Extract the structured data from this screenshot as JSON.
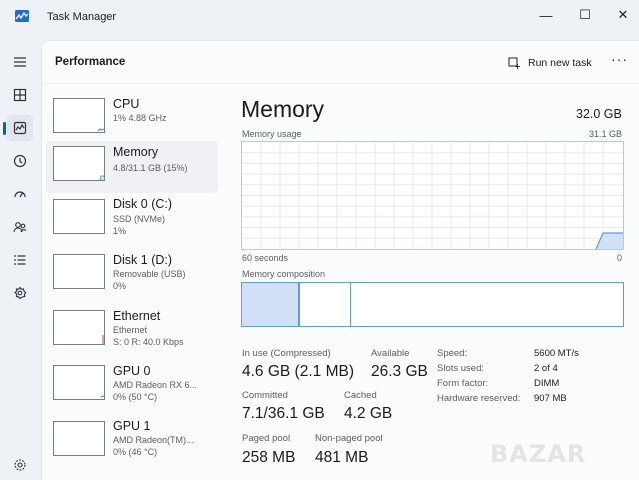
{
  "window": {
    "title": "Task Manager",
    "minimize_glyph": "—",
    "maximize_glyph": "☐",
    "close_glyph": "✕"
  },
  "header": {
    "title": "Performance",
    "run_task_label": "Run new task",
    "more_glyph": "···"
  },
  "nav": [
    "hamburger-icon",
    "processes-icon",
    "performance-icon",
    "app-history-icon",
    "startup-icon",
    "users-icon",
    "details-icon",
    "services-icon",
    "settings-icon"
  ],
  "sidebar": {
    "items": [
      {
        "name": "CPU",
        "lines": [
          "1% 4.88 GHz"
        ]
      },
      {
        "name": "Memory",
        "lines": [
          "4.8/31.1 GB (15%)"
        ]
      },
      {
        "name": "Disk 0 (C:)",
        "lines": [
          "SSD (NVMe)",
          "1%"
        ]
      },
      {
        "name": "Disk 1 (D:)",
        "lines": [
          "Removable (USB)",
          "0%"
        ]
      },
      {
        "name": "Ethernet",
        "lines": [
          "Ethernet",
          "S: 0 R: 40.0 Kbps"
        ]
      },
      {
        "name": "GPU 0",
        "lines": [
          "AMD Radeon RX 6...",
          "0% (50 °C)"
        ]
      },
      {
        "name": "GPU 1",
        "lines": [
          "AMD Radeon(TM)...",
          "0% (46 °C)"
        ]
      }
    ]
  },
  "memory": {
    "title": "Memory",
    "total": "32.0 GB",
    "usage_label": "Memory usage",
    "usage_max": "31.1 GB",
    "time_left": "60 seconds",
    "time_right": "0",
    "composition_label": "Memory composition",
    "stats": {
      "in_use_label": "In use (Compressed)",
      "in_use": "4.6 GB (2.1 MB)",
      "available_label": "Available",
      "available": "26.3 GB",
      "committed_label": "Committed",
      "committed": "7.1/36.1 GB",
      "cached_label": "Cached",
      "cached": "4.2 GB",
      "paged_label": "Paged pool",
      "paged": "258 MB",
      "nonpaged_label": "Non-paged pool",
      "nonpaged": "481 MB"
    },
    "details": [
      {
        "label": "Speed:",
        "value": "5600 MT/s"
      },
      {
        "label": "Slots used:",
        "value": "2 of 4"
      },
      {
        "label": "Form factor:",
        "value": "DIMM"
      },
      {
        "label": "Hardware reserved:",
        "value": "907 MB"
      }
    ]
  },
  "colors": {
    "accent": "#0a5fb4",
    "memory_line": "#6a9ad4",
    "memory_fill": "#cfe0f7",
    "grid": "#e3e9f2"
  },
  "watermark": "BAZAR"
}
